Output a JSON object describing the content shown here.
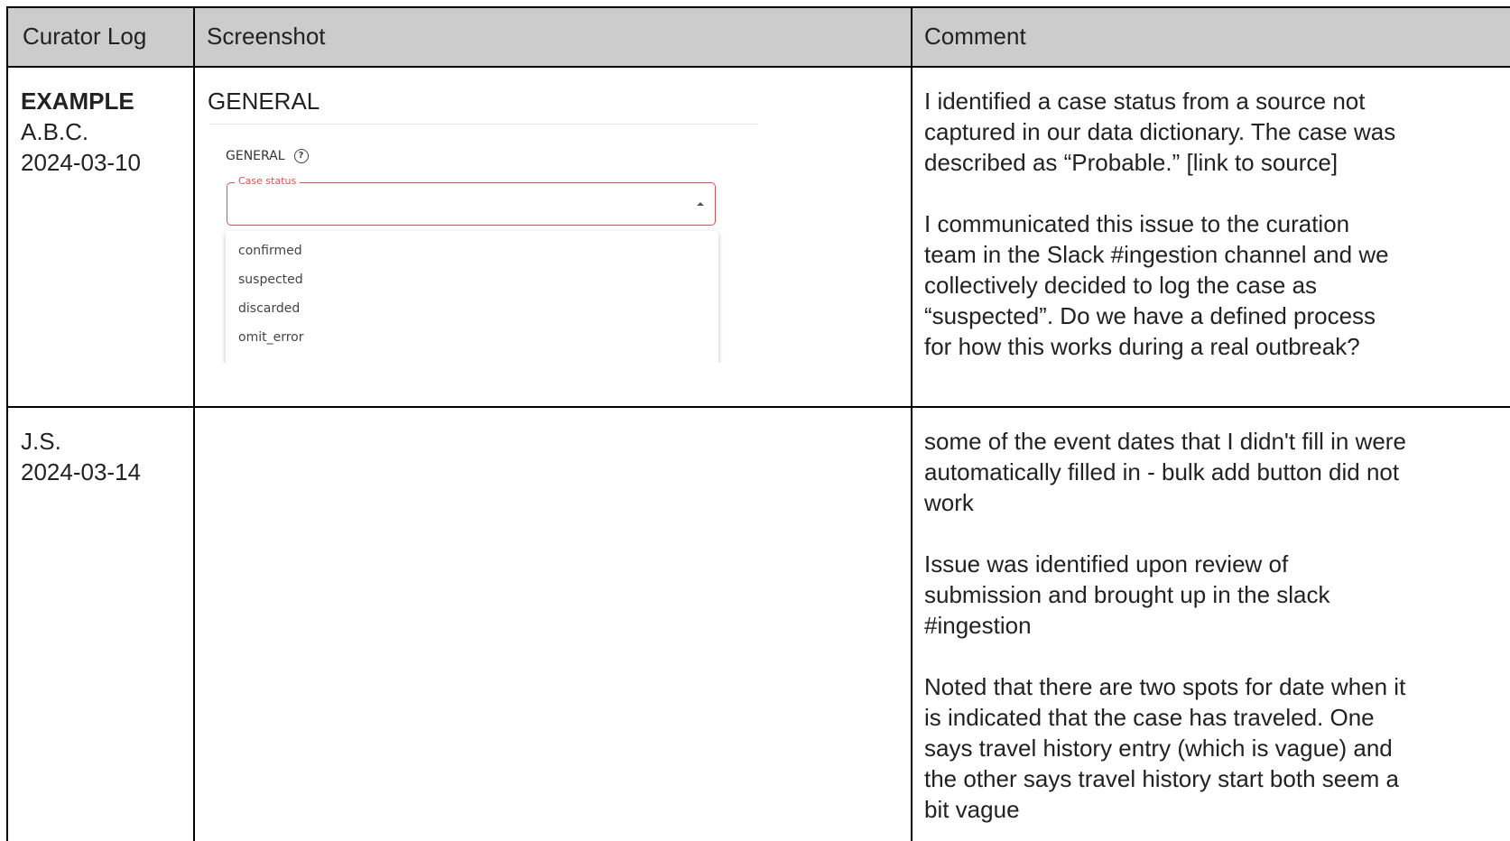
{
  "header": {
    "col1": "Curator Log",
    "col2": "Screenshot",
    "col3": "Comment"
  },
  "rows": [
    {
      "tag": "EXAMPLE",
      "initials": "A.B.C.",
      "date": "2024-03-10",
      "screenshot": {
        "caption": "GENERAL",
        "section_label": "GENERAL",
        "field_label": "Case status",
        "options": [
          "confirmed",
          "suspected",
          "discarded",
          "omit_error"
        ]
      },
      "comment": [
        [
          "I identified a case status from a source not",
          "captured in our data dictionary. The case was",
          "described as “Probable.” [link to source]"
        ],
        [
          "I communicated this issue to the curation",
          "team in the Slack #ingestion channel and we",
          "collectively decided to log the case as",
          "“suspected”. Do we have a defined process",
          "for how this works during a real outbreak?"
        ]
      ]
    },
    {
      "initials": "J.S.",
      "date": "2024-03-14",
      "comment": [
        [
          "some of the event dates that I didn't fill in were",
          "automatically filled in - bulk add button did not",
          "work"
        ],
        [
          "Issue was identified upon review of",
          "submission and brought up in the slack",
          "#ingestion"
        ],
        [
          "Noted that there are two spots for date when it",
          "is indicated that the case has traveled. One",
          "says travel history entry (which is vague) and",
          "the other says travel history start both seem a",
          "bit vague"
        ]
      ]
    }
  ]
}
